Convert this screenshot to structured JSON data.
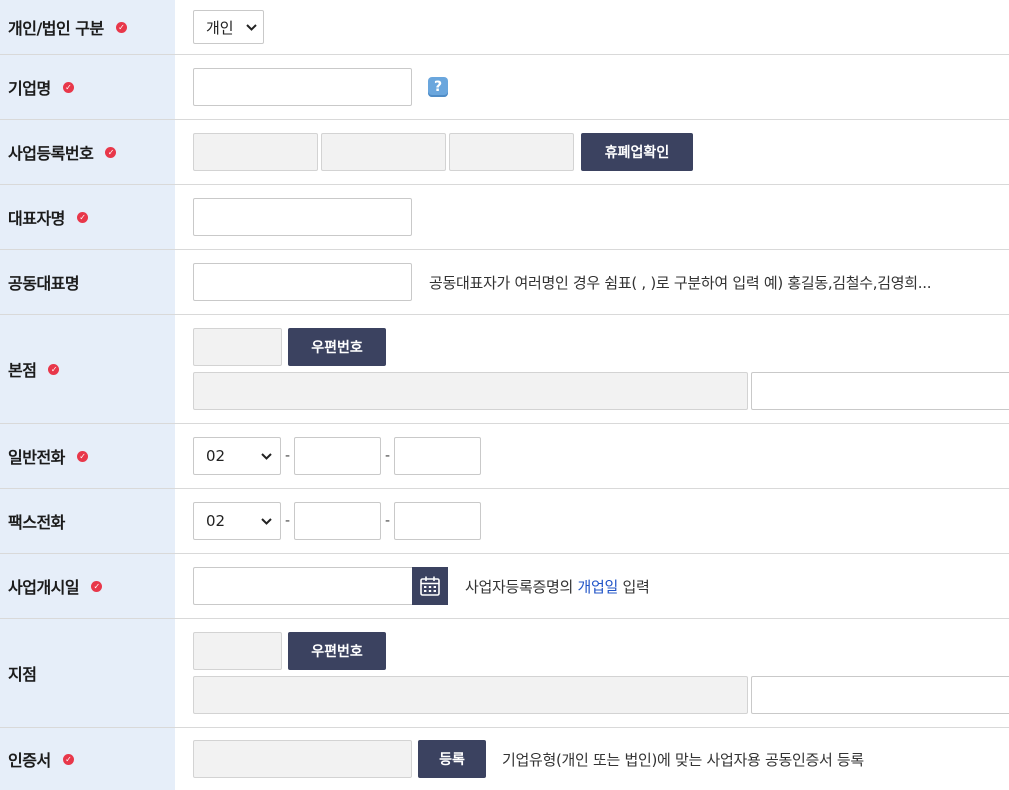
{
  "rows": {
    "type": {
      "label": "개인/법인 구분",
      "select_value": "개인"
    },
    "company": {
      "label": "기업명",
      "help_glyph": "?"
    },
    "bizno": {
      "label": "사업등록번호",
      "button": "휴폐업확인"
    },
    "ceo": {
      "label": "대표자명"
    },
    "coceo": {
      "label": "공동대표명",
      "hint": "공동대표자가 여러명인 경우 쉼표( , )로 구분하여 입력   예) 홍길동,김철수,김영희..."
    },
    "hq": {
      "label": "본점",
      "button": "우편번호"
    },
    "phone": {
      "label": "일반전화",
      "area_code": "02",
      "dash": "-"
    },
    "fax": {
      "label": "팩스전화",
      "area_code": "02",
      "dash": "-"
    },
    "opendate": {
      "label": "사업개시일",
      "hint_before": "사업자등록증명의 ",
      "hint_highlight": "개업일",
      "hint_after": " 입력"
    },
    "branch": {
      "label": "지점",
      "button": "우편번호"
    },
    "cert": {
      "label": "인증서",
      "button": "등록",
      "hint": "기업유형(개인 또는 법인)에 맞는 사업자용 공동인증서 등록"
    }
  },
  "icons": {
    "required": "check-circle-icon",
    "chevron": "chevron-down-icon",
    "calendar": "calendar-icon",
    "help": "help-icon"
  },
  "colors": {
    "label_bg": "#e6eef9",
    "button_bg": "#3b4260",
    "required": "#e8374a",
    "highlight": "#2154c7"
  }
}
